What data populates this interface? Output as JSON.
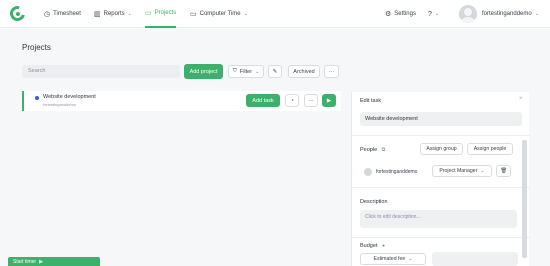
{
  "nav": {
    "items": [
      {
        "label": "Timesheet",
        "icon": "clock-icon"
      },
      {
        "label": "Reports",
        "icon": "chart-icon"
      },
      {
        "label": "Projects",
        "icon": "folder-icon"
      },
      {
        "label": "Computer Time",
        "icon": "monitor-icon"
      }
    ],
    "active": "Projects",
    "settings_label": "Settings",
    "help_icon": "question-icon",
    "user_name": "fortestinganddemo"
  },
  "page": {
    "title": "Projects"
  },
  "toolbar": {
    "search_placeholder": "Search",
    "add_project_label": "Add project",
    "filter_label": "Filter",
    "archived_label": "Archived"
  },
  "projects": [
    {
      "name": "Website development",
      "client": "fortestinganddemo",
      "dot_color": "#3b5bdb",
      "add_task_label": "Add task"
    }
  ],
  "panel": {
    "title": "Edit task",
    "project_name_value": "Website development",
    "people_label": "People",
    "assign_group_label": "Assign group",
    "assign_people_label": "Assign people",
    "member": {
      "name": "fortestinganddemo",
      "role": "Project Manager"
    },
    "description_label": "Description",
    "description_placeholder": "Click to edit description...",
    "budget_label": "Budget",
    "estimated_fee_label": "Estimated fee"
  },
  "timer": {
    "label": "Start timer"
  },
  "colors": {
    "accent": "#3db16b",
    "project_dot": "#3b5bdb"
  }
}
